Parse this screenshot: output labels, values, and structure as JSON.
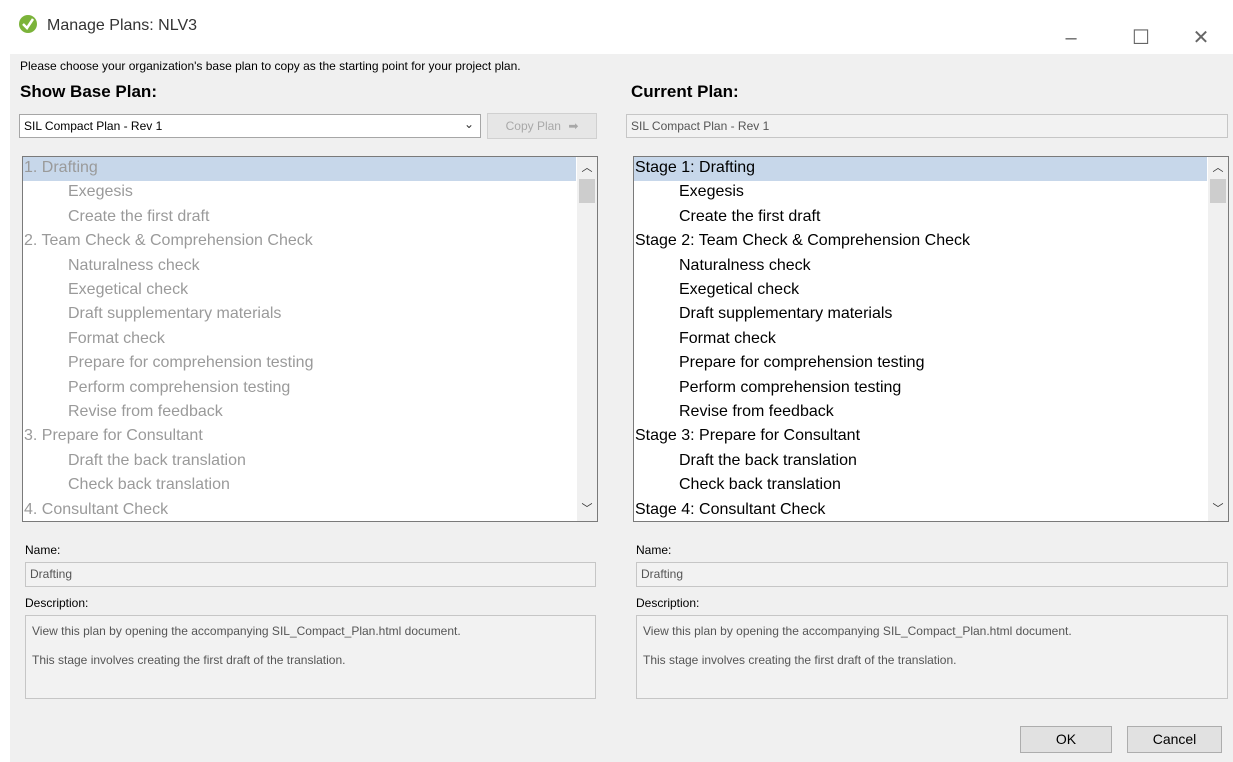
{
  "window": {
    "title": "Manage Plans: NLV3",
    "minimize_glyph": "–",
    "maximize_glyph": "☐",
    "close_glyph": "✕",
    "icon": "check-leaf-icon",
    "accent": "#6aa12a"
  },
  "instructions": "Please choose your organization's base plan to copy as the starting point for your project plan.",
  "base": {
    "header": "Show Base Plan:",
    "selected_plan": "SIL Compact Plan - Rev 1",
    "copy_button": "Copy Plan",
    "items": [
      {
        "text": "1. Drafting",
        "indent": false,
        "selected": true
      },
      {
        "text": "Exegesis",
        "indent": true
      },
      {
        "text": "Create the first draft",
        "indent": true
      },
      {
        "text": "2. Team Check & Comprehension Check",
        "indent": false
      },
      {
        "text": "Naturalness check",
        "indent": true
      },
      {
        "text": "Exegetical check",
        "indent": true
      },
      {
        "text": "Draft supplementary materials",
        "indent": true
      },
      {
        "text": "Format check",
        "indent": true
      },
      {
        "text": "Prepare for comprehension testing",
        "indent": true
      },
      {
        "text": "Perform comprehension testing",
        "indent": true
      },
      {
        "text": "Revise from feedback",
        "indent": true
      },
      {
        "text": "3. Prepare for Consultant",
        "indent": false
      },
      {
        "text": "Draft the back translation",
        "indent": true
      },
      {
        "text": "Check back translation",
        "indent": true
      },
      {
        "text": "4. Consultant Check",
        "indent": false
      }
    ],
    "name_label": "Name:",
    "name_value": "Drafting",
    "description_label": "Description:",
    "description_lines": [
      "View this plan by opening the accompanying SIL_Compact_Plan.html document.",
      "This stage involves creating the first draft of the translation."
    ]
  },
  "current": {
    "header": "Current Plan:",
    "plan_name": "SIL Compact Plan - Rev 1",
    "items": [
      {
        "text": "Stage 1: Drafting",
        "indent": false,
        "selected": true
      },
      {
        "text": "Exegesis",
        "indent": true
      },
      {
        "text": "Create the first draft",
        "indent": true
      },
      {
        "text": "Stage 2: Team Check & Comprehension Check",
        "indent": false
      },
      {
        "text": "Naturalness check",
        "indent": true
      },
      {
        "text": "Exegetical check",
        "indent": true
      },
      {
        "text": "Draft supplementary materials",
        "indent": true
      },
      {
        "text": "Format check",
        "indent": true
      },
      {
        "text": "Prepare for comprehension testing",
        "indent": true
      },
      {
        "text": "Perform comprehension testing",
        "indent": true
      },
      {
        "text": "Revise from feedback",
        "indent": true
      },
      {
        "text": "Stage 3: Prepare for Consultant",
        "indent": false
      },
      {
        "text": "Draft the back translation",
        "indent": true
      },
      {
        "text": "Check back translation",
        "indent": true
      },
      {
        "text": "Stage 4: Consultant Check",
        "indent": false
      }
    ],
    "name_label": "Name:",
    "name_value": "Drafting",
    "description_label": "Description:",
    "description_lines": [
      "View this plan by opening the accompanying SIL_Compact_Plan.html document.",
      "This stage involves creating the first draft of the translation."
    ]
  },
  "buttons": {
    "ok": "OK",
    "cancel": "Cancel"
  }
}
